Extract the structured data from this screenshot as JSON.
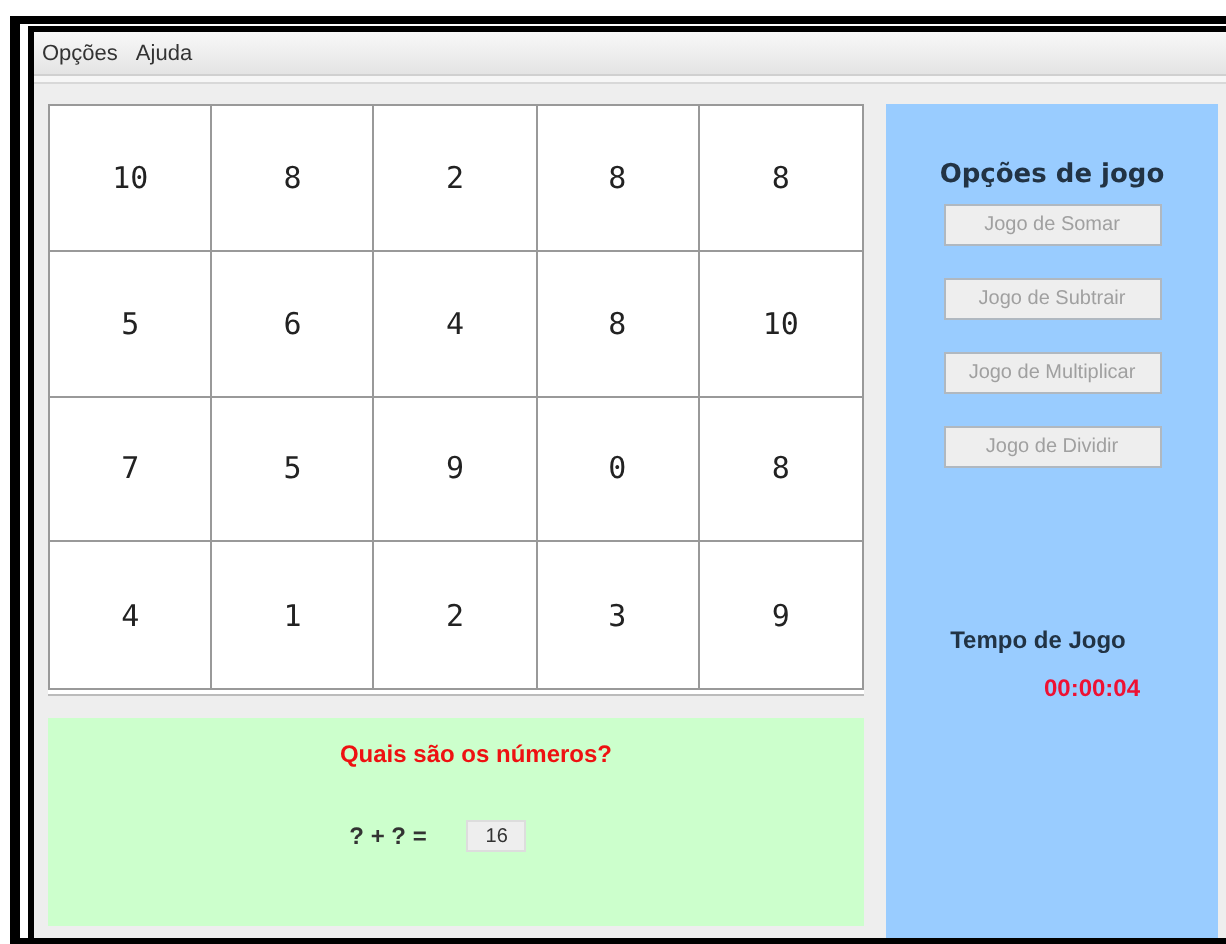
{
  "menu": [
    "Opções",
    "Ajuda"
  ],
  "grid": [
    [
      "10",
      "8",
      "2",
      "8",
      "8"
    ],
    [
      "5",
      "6",
      "4",
      "8",
      "10"
    ],
    [
      "7",
      "5",
      "9",
      "0",
      "8"
    ],
    [
      "4",
      "1",
      "2",
      "3",
      "9"
    ]
  ],
  "question": {
    "title": "Quais são os números?",
    "equation": "? + ? =",
    "answer": "16"
  },
  "options": {
    "title": "Opções de jogo",
    "buttons": [
      {
        "label": "Jogo de Somar",
        "disabled": true
      },
      {
        "label": "Jogo de Subtrair",
        "disabled": true
      },
      {
        "label": "Jogo de Multiplicar",
        "disabled": true
      },
      {
        "label": "Jogo de Dividir",
        "disabled": true
      }
    ],
    "timer_label": "Tempo de Jogo",
    "timer": "00:00:04"
  }
}
